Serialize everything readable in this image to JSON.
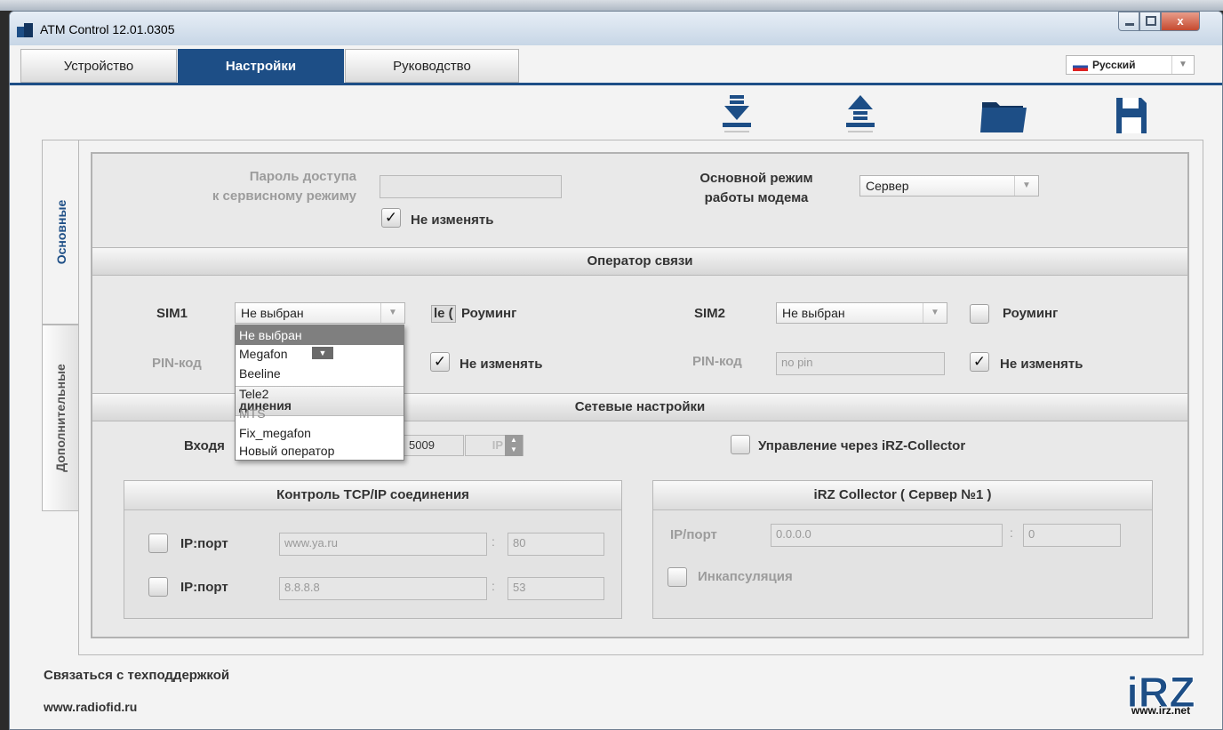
{
  "window": {
    "title": "ATM Control 12.01.0305",
    "close_glyph": "x"
  },
  "menu": {
    "tabs": [
      {
        "label": "Устройство"
      },
      {
        "label": "Настройки"
      },
      {
        "label": "Руководство"
      }
    ],
    "language": "Русский"
  },
  "toolbar": {
    "icons": [
      "download-icon",
      "upload-icon",
      "folder-icon",
      "save-icon"
    ]
  },
  "side_tabs": [
    {
      "label": "Основные"
    },
    {
      "label": "Дополнительные"
    }
  ],
  "general": {
    "password_label_line1": "Пароль доступа",
    "password_label_line2": "к сервисному режиму",
    "password_value": "",
    "no_change_label": "Не изменять",
    "no_change_checked": "✓",
    "modem_mode_label_line1": "Основной режим",
    "modem_mode_label_line2": "работы модема",
    "modem_mode_value": "Сервер"
  },
  "operator": {
    "section_title": "Оператор связи",
    "sim1_label": "SIM1",
    "sim1_value": "Не выбран",
    "sim1_roaming_label": "Роуминг",
    "sim1_roaming_partial": "le (",
    "sim1_pin_label": "PIN-код",
    "sim1_no_change_label": "Не изменять",
    "sim2_label": "SIM2",
    "sim2_value": "Не выбран",
    "sim2_roaming_label": "Роуминг",
    "sim2_pin_label": "PIN-код",
    "sim2_pin_value": "no pin",
    "sim2_no_change_label": "Не изменять",
    "check": "✓"
  },
  "network": {
    "section_title": "Сетевые настройки",
    "incoming_label_partial": "Входя",
    "port_value": "5009",
    "ip_type": "IP",
    "collector_label": "Управление через iRZ-Collector"
  },
  "tcp_control": {
    "title": "Контроль TCP/IP соединения",
    "rows": [
      {
        "label": "IP:порт",
        "host": "www.ya.ru",
        "port": "80"
      },
      {
        "label": "IP:порт",
        "host": "8.8.8.8",
        "port": "53"
      }
    ],
    "separator": ":"
  },
  "collector": {
    "title": "iRZ Collector ( Сервер №1 )",
    "ip_label": "IP/порт",
    "ip_value": "0.0.0.0",
    "port_value": "0",
    "separator": ":",
    "encapsulation_label": "Инкапсуляция"
  },
  "dropdown": {
    "options": [
      {
        "label": "Не выбран",
        "highlighted": true
      },
      {
        "label": "Megafon"
      },
      {
        "label": "Beeline"
      },
      {
        "label": "Tele2"
      },
      {
        "label": "MTS"
      },
      {
        "label": "Fix_megafon"
      },
      {
        "label": "Новый оператор"
      }
    ],
    "overlap_text": "динения"
  },
  "footer": {
    "support_link": "Связаться с техподдержкой",
    "website": "www.radiofid.ru",
    "logo_url": "www.irz.net",
    "logo_text": "iRZ"
  },
  "colors": {
    "accent": "#1d4e86",
    "disabled_text": "#9c9c9c"
  }
}
